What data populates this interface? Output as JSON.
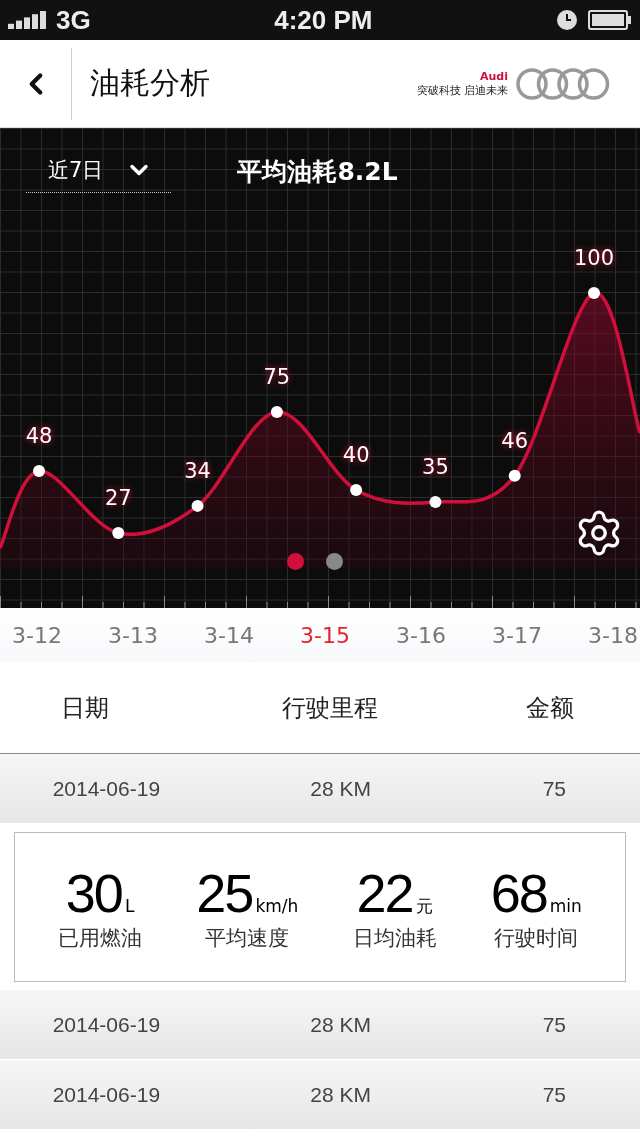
{
  "status_bar": {
    "network": "3G",
    "time": "4:20 PM"
  },
  "header": {
    "title": "油耗分析",
    "brand": "Audi",
    "slogan": "突破科技 启迪未来"
  },
  "chart_panel": {
    "period": "近7日",
    "summary": "平均油耗8.2L",
    "point_labels": [
      "48",
      "27",
      "34",
      "75",
      "40",
      "35",
      "46",
      "100"
    ],
    "pager": [
      {
        "selected": true
      },
      {
        "selected": false
      }
    ]
  },
  "dates": [
    {
      "label": "3-12",
      "selected": false
    },
    {
      "label": "3-13",
      "selected": false
    },
    {
      "label": "3-14",
      "selected": false
    },
    {
      "label": "3-15",
      "selected": true
    },
    {
      "label": "3-16",
      "selected": false
    },
    {
      "label": "3-17",
      "selected": false
    },
    {
      "label": "3-18",
      "selected": false
    }
  ],
  "table": {
    "columns": [
      "日期",
      "行驶里程",
      "金额"
    ],
    "rows": [
      {
        "date": "2014-06-19",
        "distance": "28 KM",
        "amount": "75",
        "details": [
          {
            "value": "30",
            "unit": "L",
            "label": "已用燃油"
          },
          {
            "value": "25",
            "unit": "km/h",
            "label": "平均速度"
          },
          {
            "value": "22",
            "unit": "元",
            "label": "日均油耗"
          },
          {
            "value": "68",
            "unit": "min",
            "label": "行驶时间"
          }
        ]
      },
      {
        "date": "2014-06-19",
        "distance": "28 KM",
        "amount": "75"
      },
      {
        "date": "2014-06-19",
        "distance": "28 KM",
        "amount": "75"
      }
    ]
  }
}
